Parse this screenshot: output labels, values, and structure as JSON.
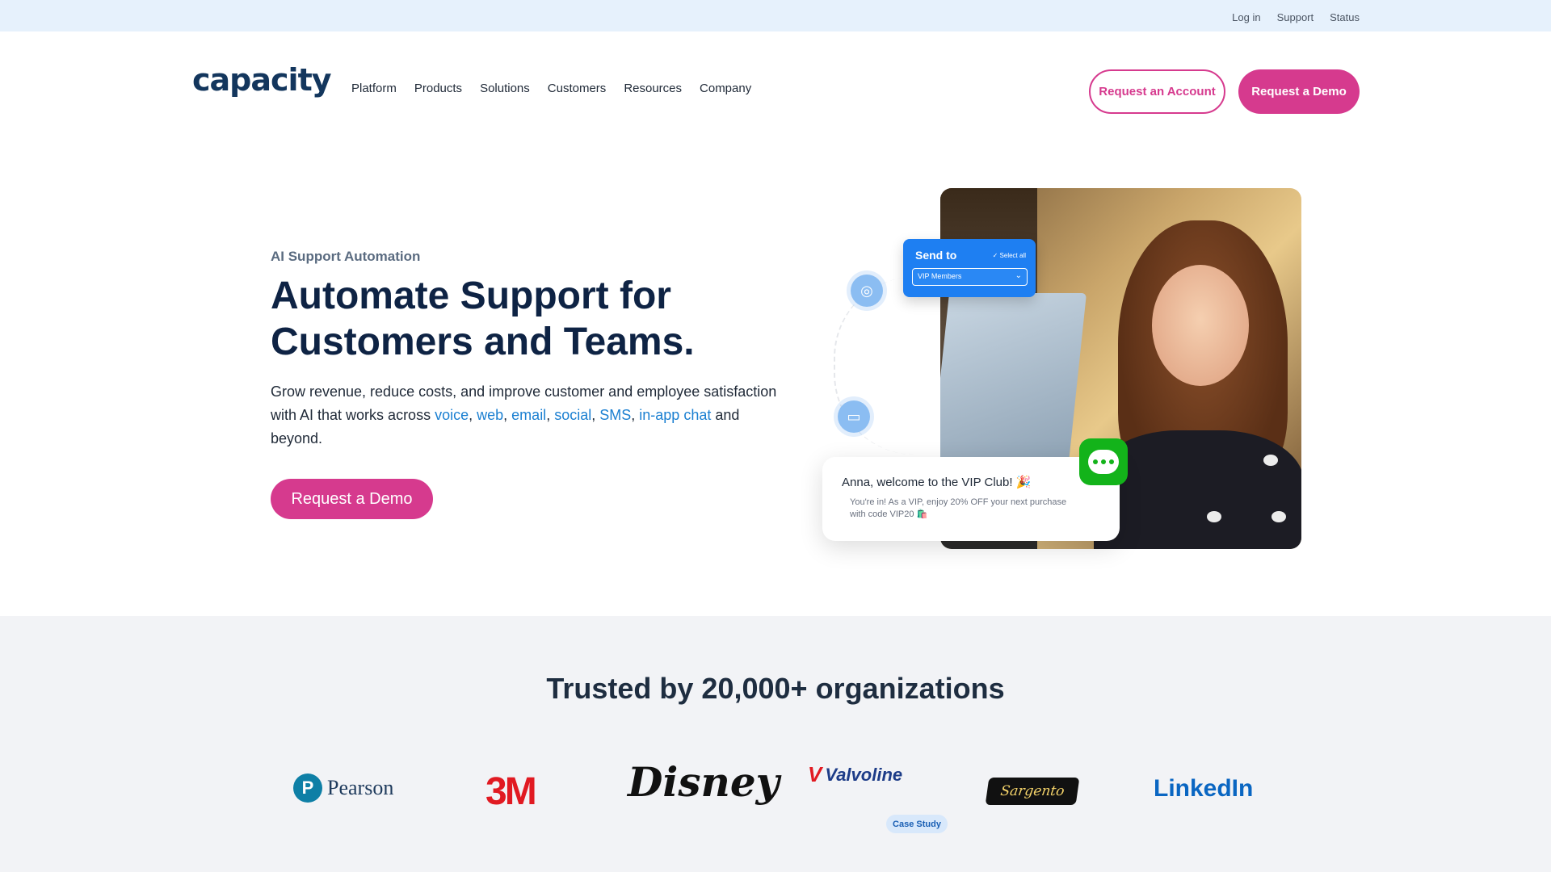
{
  "utility_nav": {
    "items": [
      "Log in",
      "Support",
      "Status"
    ]
  },
  "brand": {
    "logo_text": "capacity"
  },
  "main_nav": {
    "items": [
      "Platform",
      "Products",
      "Solutions",
      "Customers",
      "Resources",
      "Company"
    ]
  },
  "header_actions": {
    "request_account": "Request an Account",
    "request_demo": "Request a Demo"
  },
  "hero": {
    "eyebrow": "AI Support Automation",
    "headline": "Automate Support for Customers and Teams.",
    "subtext_lead": "Grow revenue, reduce costs, and improve customer and employee satisfaction with AI that works across ",
    "channels": [
      "voice",
      "web",
      "email",
      "social",
      "SMS",
      "in-app chat"
    ],
    "subtext_tail": " and beyond.",
    "cta": "Request a Demo"
  },
  "send_card": {
    "title": "Send to",
    "select_all": "Select all",
    "selected": "VIP Members"
  },
  "notification": {
    "title": "Anna, welcome to the VIP Club! 🎉",
    "body": "You're in! As a VIP, enjoy 20% OFF your next purchase with code VIP20 🛍️"
  },
  "trusted": {
    "title": "Trusted by 20,000+ organizations",
    "logos": [
      "Pearson",
      "3M",
      "Disney",
      "Valvoline",
      "Sargento",
      "LinkedIn"
    ],
    "case_study_badge": "Case Study"
  },
  "colors": {
    "brand_navy": "#13365d",
    "accent_pink": "#d63a8e",
    "link_blue": "#1a7fd1",
    "utility_bar": "#e6f1fc",
    "trusted_bg": "#f2f3f6",
    "send_card_blue": "#1e7ff2",
    "chat_green": "#13b31a"
  }
}
